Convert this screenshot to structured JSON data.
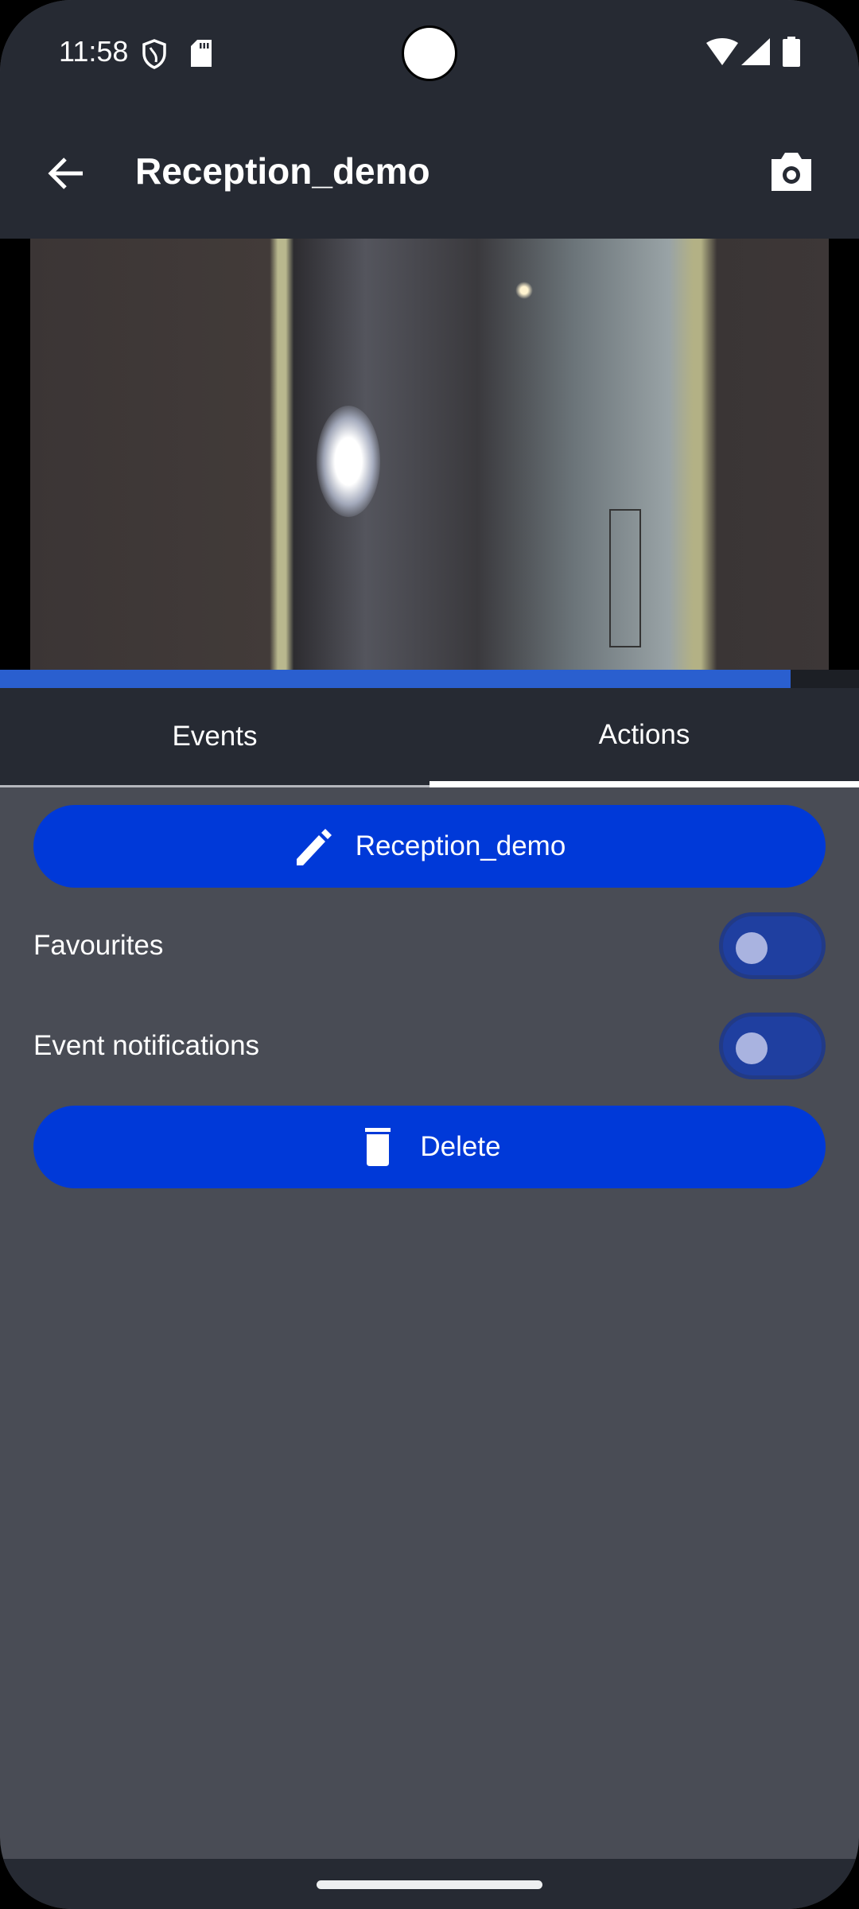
{
  "status_bar": {
    "time": "11:58",
    "icons": [
      "vpn-shield-icon",
      "sd-card-icon",
      "wifi-icon",
      "signal-icon",
      "battery-icon"
    ]
  },
  "app_bar": {
    "back_icon": "arrow-back-icon",
    "title": "Reception_demo",
    "action_icon": "camera-icon"
  },
  "video": {
    "progress_fraction": 0.92,
    "progress_color": "#2a5fcf"
  },
  "tabs": [
    {
      "label": "Events",
      "selected": false
    },
    {
      "label": "Actions",
      "selected": true
    }
  ],
  "actions": {
    "rename_button": {
      "icon": "pencil-icon",
      "label": "Reception_demo"
    },
    "favourites": {
      "label": "Favourites",
      "on": false
    },
    "event_notifications": {
      "label": "Event notifications",
      "on": false
    },
    "delete_button": {
      "icon": "trash-icon",
      "label": "Delete"
    }
  },
  "colors": {
    "accent": "#0039d8",
    "app_bar": "#262a33",
    "background": "#494c55"
  }
}
